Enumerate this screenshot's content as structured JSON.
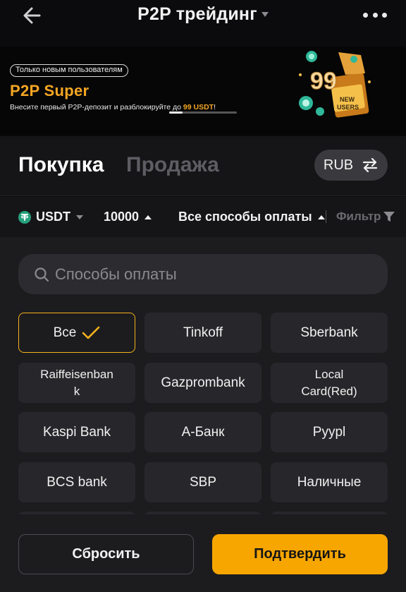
{
  "header": {
    "title": "P2P трейдинг",
    "back_icon": "arrow-left-icon",
    "more_icon": "more-horizontal-icon"
  },
  "banner": {
    "pill": "Только новым пользователям",
    "title": "P2P Super",
    "description_prefix": "Внесите первый P2P-депозит и разблокируйте до ",
    "highlight": "99 USDT",
    "description_suffix": "!",
    "art_number": "99",
    "art_line1": "NEW",
    "art_line2": "USERS",
    "slide_progress": 0.2
  },
  "trade": {
    "buy_tab": "Покупка",
    "sell_tab": "Продажа",
    "currency": "RUB",
    "swap_icon": "swap-icon"
  },
  "filters": {
    "coin": "USDT",
    "amount": "10000",
    "payment": "Все способы оплаты",
    "filter": "Фильтр"
  },
  "payment_panel": {
    "search_placeholder": "Способы оплаты",
    "methods": [
      {
        "label": "Все",
        "selected": true
      },
      {
        "label": "Tinkoff",
        "selected": false
      },
      {
        "label": "Sberbank",
        "selected": false
      },
      {
        "label": "Raiffeisenban\nk",
        "selected": false
      },
      {
        "label": "Gazprombank",
        "selected": false
      },
      {
        "label": "Local\nCard(Red)",
        "selected": false
      },
      {
        "label": "Kaspi Bank",
        "selected": false
      },
      {
        "label": "А-Банк",
        "selected": false
      },
      {
        "label": "Pyypl",
        "selected": false
      },
      {
        "label": "BCS bank",
        "selected": false
      },
      {
        "label": "SBP",
        "selected": false
      },
      {
        "label": "Наличные",
        "selected": false
      }
    ]
  },
  "footer": {
    "reset": "Сбросить",
    "confirm": "Подтвердить"
  },
  "colors": {
    "accent": "#f7a600",
    "background": "#0b0b0d",
    "panel": "#1c1c1f"
  }
}
